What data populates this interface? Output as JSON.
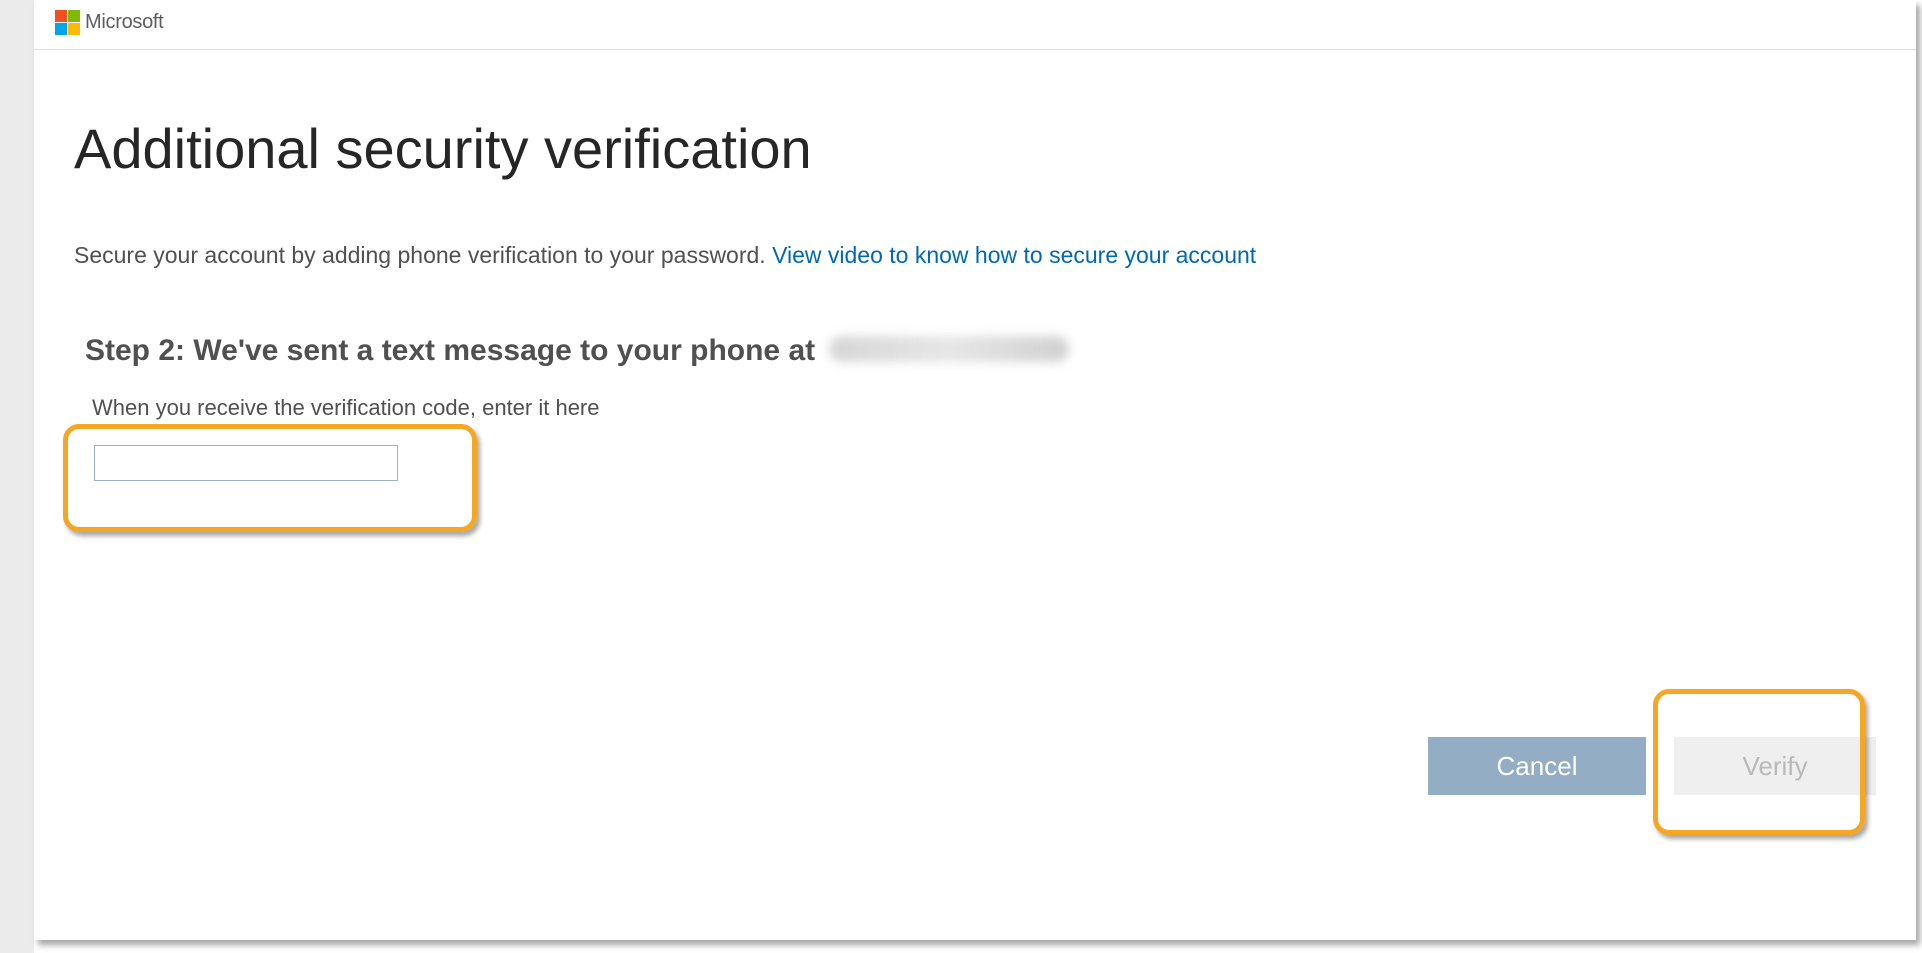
{
  "header": {
    "brand_name": "Microsoft",
    "logo_icon": "microsoft-logo-icon",
    "logo_colors": [
      "#f25022",
      "#7fba00",
      "#00a4ef",
      "#ffb900"
    ]
  },
  "main": {
    "title": "Additional security verification",
    "intro_text": "Secure your account by adding phone verification to your password.",
    "intro_link": "View video to know how to secure your account",
    "step_heading": "Step 2: We've sent a text message to your phone at",
    "code_label": "When you receive the verification code, enter it here",
    "code_input": {
      "value": "",
      "placeholder": ""
    }
  },
  "actions": {
    "cancel_label": "Cancel",
    "verify_label": "Verify"
  },
  "colors": {
    "link": "#0067b8",
    "highlight": "#f5a623",
    "cancel_bg": "#93adc4",
    "verify_bg": "#efefef"
  }
}
